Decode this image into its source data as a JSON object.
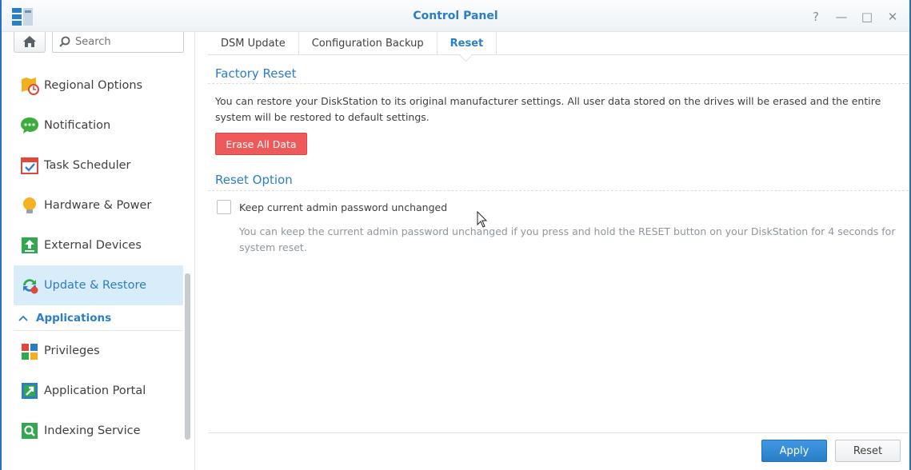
{
  "window": {
    "title": "Control Panel",
    "controls": [
      "?",
      "—",
      "□",
      "✕"
    ],
    "accent": "#2a7ec6"
  },
  "sidebar": {
    "search_placeholder": "Search",
    "items": [
      {
        "label": "Regional Options",
        "icon": "map-clock-icon"
      },
      {
        "label": "Notification",
        "icon": "chat-bubble-icon"
      },
      {
        "label": "Task Scheduler",
        "icon": "calendar-check-icon"
      },
      {
        "label": "Hardware & Power",
        "icon": "lightbulb-icon"
      },
      {
        "label": "External Devices",
        "icon": "upload-icon"
      },
      {
        "label": "Update & Restore",
        "icon": "refresh-icon",
        "active": true
      }
    ],
    "section": "Applications",
    "app_items": [
      {
        "label": "Privileges",
        "icon": "grid-lock-icon"
      },
      {
        "label": "Application Portal",
        "icon": "arrow-portal-icon"
      },
      {
        "label": "Indexing Service",
        "icon": "magnifier-icon"
      }
    ]
  },
  "tabs": [
    {
      "label": "DSM Update"
    },
    {
      "label": "Configuration Backup"
    },
    {
      "label": "Reset",
      "active": true
    }
  ],
  "factory_reset": {
    "title": "Factory Reset",
    "description": "You can restore your DiskStation to its original manufacturer settings. All user data stored on the drives will be erased and the entire system will be restored to default settings.",
    "button": "Erase All Data",
    "button_color": "#ee5a5a"
  },
  "reset_option": {
    "title": "Reset Option",
    "checkbox_label": "Keep current admin password unchanged",
    "checked": false,
    "hint": "You can keep the current admin password unchanged if you press and hold the RESET button on your DiskStation for 4 seconds for system reset."
  },
  "footer": {
    "apply": "Apply",
    "reset": "Reset"
  }
}
